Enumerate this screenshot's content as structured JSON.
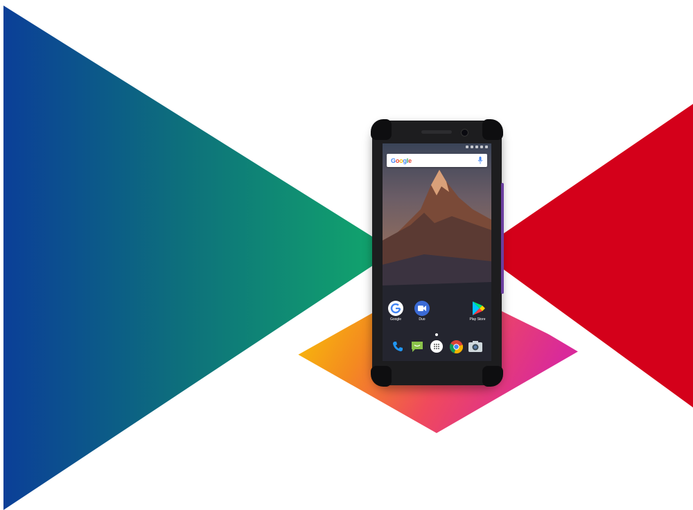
{
  "search_bar": {
    "logo_text": "Google"
  },
  "home_apps": [
    {
      "label": "Google",
      "icon": "google-app-icon"
    },
    {
      "label": "Duo",
      "icon": "duo-icon"
    },
    {
      "label": "Play Store",
      "icon": "play-store-icon"
    }
  ],
  "dock_apps": [
    "phone-icon",
    "messages-icon",
    "app-drawer-icon",
    "chrome-icon",
    "camera-icon"
  ],
  "colors": {
    "left_triangle_start": "#0b3d95",
    "left_triangle_end": "#13a86a",
    "right_triangle": "#d4001a",
    "diamond_start": "#f7c600",
    "diamond_mid": "#f26a2a",
    "diamond_end": "#e02a8f",
    "phone_accent": "#6b3fa0"
  }
}
